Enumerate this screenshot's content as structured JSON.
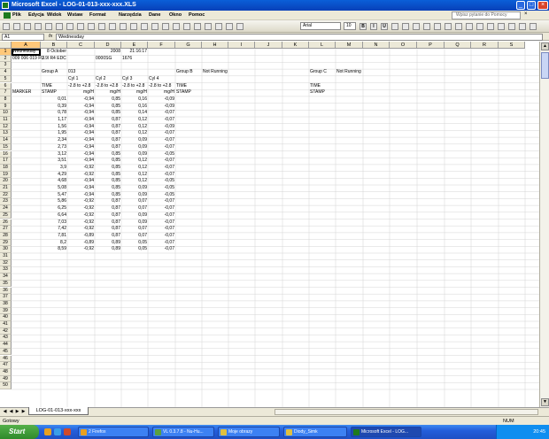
{
  "window": {
    "title": "Microsoft Excel - LOG-01-013-xxx-xxx.XLS"
  },
  "menu": {
    "items": [
      "Plik",
      "Edycja",
      "Widok",
      "Wstaw",
      "Format",
      "Narzędzia",
      "Dane",
      "Okno",
      "Pomoc"
    ],
    "help_placeholder": "Wpisz pytanie do Pomocy"
  },
  "toolbar": {
    "font": "Arial",
    "size": "10"
  },
  "formula": {
    "namebox": "A1",
    "fx": "fx",
    "content": "Wednesday"
  },
  "columns": [
    "A",
    "B",
    "C",
    "D",
    "E",
    "F",
    "G",
    "H",
    "I",
    "J",
    "K",
    "L",
    "M",
    "N",
    "O",
    "P",
    "Q",
    "R",
    "S"
  ],
  "row_count": 50,
  "cells": [
    {
      "r": 1,
      "c": "A",
      "v": "Wednesday"
    },
    {
      "r": 1,
      "c": "B",
      "v": "8 October",
      "align": "right"
    },
    {
      "r": 1,
      "c": "D",
      "v": "2008",
      "align": "right"
    },
    {
      "r": 1,
      "c": "E",
      "v": "21:16:17",
      "align": "right"
    },
    {
      "r": 2,
      "c": "A",
      "v": "009 006 019 FU"
    },
    {
      "r": 2,
      "c": "B",
      "v": "1.9l R4 EDC"
    },
    {
      "r": 2,
      "c": "D",
      "v": "0000SG"
    },
    {
      "r": 2,
      "c": "E",
      "v": "1676"
    },
    {
      "r": 4,
      "c": "B",
      "v": "Group A"
    },
    {
      "r": 4,
      "c": "C",
      "v": "013"
    },
    {
      "r": 4,
      "c": "G",
      "v": "Group B"
    },
    {
      "r": 4,
      "c": "H",
      "v": "Not Running"
    },
    {
      "r": 4,
      "c": "L",
      "v": "Group C"
    },
    {
      "r": 4,
      "c": "M",
      "v": "Not Running"
    },
    {
      "r": 5,
      "c": "C",
      "v": "Cyl 1"
    },
    {
      "r": 5,
      "c": "D",
      "v": "Cyl 2"
    },
    {
      "r": 5,
      "c": "E",
      "v": "Cyl 3"
    },
    {
      "r": 5,
      "c": "F",
      "v": "Cyl 4"
    },
    {
      "r": 6,
      "c": "B",
      "v": "TIME"
    },
    {
      "r": 6,
      "c": "C",
      "v": "-2.8 to +2.8"
    },
    {
      "r": 6,
      "c": "D",
      "v": "-2.8 to +2.8"
    },
    {
      "r": 6,
      "c": "E",
      "v": "-2.8 to +2.8"
    },
    {
      "r": 6,
      "c": "F",
      "v": "-2.8 to +2.8"
    },
    {
      "r": 6,
      "c": "G",
      "v": "TIME"
    },
    {
      "r": 6,
      "c": "L",
      "v": "TIME"
    },
    {
      "r": 7,
      "c": "A",
      "v": "MARKER"
    },
    {
      "r": 7,
      "c": "B",
      "v": "STAMP"
    },
    {
      "r": 7,
      "c": "C",
      "v": "mg/H",
      "align": "right"
    },
    {
      "r": 7,
      "c": "D",
      "v": "mg/H",
      "align": "right"
    },
    {
      "r": 7,
      "c": "E",
      "v": "mg/H",
      "align": "right"
    },
    {
      "r": 7,
      "c": "F",
      "v": "mg/H",
      "align": "right"
    },
    {
      "r": 7,
      "c": "G",
      "v": "STAMP"
    },
    {
      "r": 7,
      "c": "L",
      "v": "STAMP"
    }
  ],
  "data_rows": [
    [
      "0,01",
      "-0,94",
      "0,85",
      "0,16",
      "-0,09"
    ],
    [
      "0,39",
      "-0,94",
      "0,85",
      "0,16",
      "-0,09"
    ],
    [
      "0,78",
      "-0,94",
      "0,85",
      "0,14",
      "-0,07"
    ],
    [
      "1,17",
      "-0,94",
      "0,87",
      "0,12",
      "-0,07"
    ],
    [
      "1,56",
      "-0,94",
      "0,87",
      "0,12",
      "-0,09"
    ],
    [
      "1,95",
      "-0,94",
      "0,87",
      "0,12",
      "-0,07"
    ],
    [
      "2,34",
      "-0,94",
      "0,87",
      "0,09",
      "-0,07"
    ],
    [
      "2,73",
      "-0,94",
      "0,87",
      "0,09",
      "-0,07"
    ],
    [
      "3,12",
      "-0,94",
      "0,85",
      "0,09",
      "-0,05"
    ],
    [
      "3,51",
      "-0,94",
      "0,85",
      "0,12",
      "-0,07"
    ],
    [
      "3,9",
      "-0,92",
      "0,85",
      "0,12",
      "-0,07"
    ],
    [
      "4,29",
      "-0,92",
      "0,85",
      "0,12",
      "-0,07"
    ],
    [
      "4,68",
      "-0,94",
      "0,85",
      "0,12",
      "-0,05"
    ],
    [
      "5,08",
      "-0,94",
      "0,85",
      "0,09",
      "-0,05"
    ],
    [
      "5,47",
      "-0,94",
      "0,85",
      "0,09",
      "-0,05"
    ],
    [
      "5,86",
      "-0,92",
      "0,87",
      "0,07",
      "-0,07"
    ],
    [
      "6,25",
      "-0,92",
      "0,87",
      "0,07",
      "-0,07"
    ],
    [
      "6,64",
      "-0,92",
      "0,87",
      "0,09",
      "-0,07"
    ],
    [
      "7,03",
      "-0,92",
      "0,87",
      "0,09",
      "-0,07"
    ],
    [
      "7,42",
      "-0,92",
      "0,87",
      "0,07",
      "-0,07"
    ],
    [
      "7,81",
      "-0,89",
      "0,87",
      "0,07",
      "-0,07"
    ],
    [
      "8,2",
      "-0,89",
      "0,89",
      "0,05",
      "-0,07"
    ],
    [
      "8,59",
      "-0,92",
      "0,89",
      "0,05",
      "-0,07"
    ]
  ],
  "sheet": {
    "tab": "LOG-01-013-xxx-xxx"
  },
  "status": {
    "left": "Gotowy",
    "right": "NUM"
  },
  "taskbar": {
    "start": "Start",
    "tasks": [
      "2 Firefox",
      "VL 0.3.7.8 - Nu-Hu...",
      "Moje obrazy",
      "Diody_Simk",
      "Microsoft Excel - LOG..."
    ],
    "clock": "20:45"
  },
  "colors": {
    "titlebar": "#0a5fd8",
    "selected_header": "#ffc87a",
    "taskbar": "#245edb",
    "start": "#2f8a2a"
  }
}
